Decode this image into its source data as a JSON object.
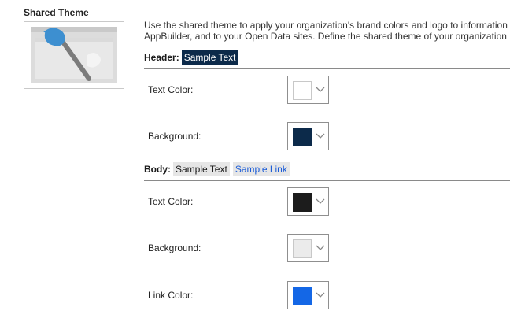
{
  "section": {
    "title": "Shared Theme"
  },
  "description": {
    "line1": "Use the shared theme to apply your organization's brand colors and logo to information",
    "line2": "AppBuilder, and to your Open Data sites. Define the shared theme of your organization ("
  },
  "header": {
    "label": "Header:",
    "sample_text": "Sample Text",
    "rows": [
      {
        "label": "Text Color:",
        "color": "#ffffff"
      },
      {
        "label": "Background:",
        "color": "#0c2a4a"
      }
    ]
  },
  "body": {
    "label": "Body:",
    "sample_text": "Sample Text",
    "sample_link": "Sample Link",
    "rows": [
      {
        "label": "Text Color:",
        "color": "#1c1c1c"
      },
      {
        "label": "Background:",
        "color": "#ebebeb"
      },
      {
        "label": "Link Color:",
        "color": "#1467e6"
      }
    ]
  },
  "icons": {
    "thumbnail": "theme-paintbrush-thumbnail-icon",
    "dropdown": "chevron-down-icon"
  }
}
